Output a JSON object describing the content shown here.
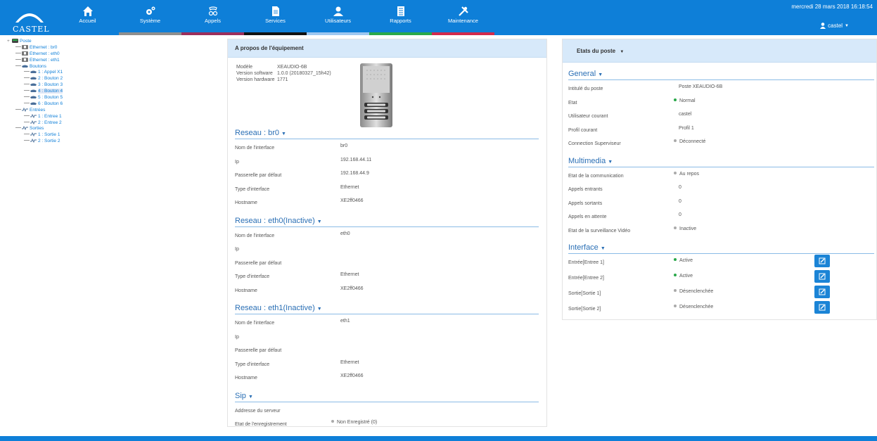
{
  "header": {
    "logo_text": "CASTEL",
    "datetime": "mercredi 28 mars 2018 16:18:54",
    "user": "castel",
    "nav": [
      {
        "label": "Accueil",
        "icon": "home-icon",
        "stripe": "#0e7fd8"
      },
      {
        "label": "Système",
        "icon": "gears-icon",
        "stripe": "#8e8e8e"
      },
      {
        "label": "Appels",
        "icon": "phone-icon",
        "stripe": "#9b2f5c"
      },
      {
        "label": "Services",
        "icon": "document-icon",
        "stripe": "#111111"
      },
      {
        "label": "Utilisateurs",
        "icon": "users-icon",
        "stripe": "#9ec7f0"
      },
      {
        "label": "Rapports",
        "icon": "report-icon",
        "stripe": "#2aa84a"
      },
      {
        "label": "Maintenance",
        "icon": "tools-icon",
        "stripe": "#d22a4c"
      }
    ]
  },
  "tree": [
    {
      "label": "Poste",
      "indent": 0,
      "icon": "device"
    },
    {
      "label": "Ethernet : br0",
      "indent": 1,
      "icon": "shield"
    },
    {
      "label": "Ethernet : eth0",
      "indent": 1,
      "icon": "shield"
    },
    {
      "label": "Ethernet : eth1",
      "indent": 1,
      "icon": "shield"
    },
    {
      "label": "Boutons",
      "indent": 1,
      "icon": "phone"
    },
    {
      "label": "1 : Appel X1",
      "indent": 2,
      "icon": "phone"
    },
    {
      "label": "2 : Bouton 2",
      "indent": 2,
      "icon": "phone"
    },
    {
      "label": "3 : Bouton 3",
      "indent": 2,
      "icon": "phone"
    },
    {
      "label": "4 : Bouton 4",
      "indent": 2,
      "icon": "phone",
      "highlight": true
    },
    {
      "label": "5 : Bouton 5",
      "indent": 2,
      "icon": "phone"
    },
    {
      "label": "6 : Bouton 6",
      "indent": 2,
      "icon": "phone"
    },
    {
      "label": "Entrées",
      "indent": 1,
      "icon": "wave"
    },
    {
      "label": "1 : Entree 1",
      "indent": 2,
      "icon": "wave"
    },
    {
      "label": "2 : Entree 2",
      "indent": 2,
      "icon": "wave"
    },
    {
      "label": "Sorties",
      "indent": 1,
      "icon": "wave"
    },
    {
      "label": "1 : Sortie 1",
      "indent": 2,
      "icon": "wave"
    },
    {
      "label": "2 : Sortie 2",
      "indent": 2,
      "icon": "wave"
    }
  ],
  "about": {
    "title": "A propos de l'équipement",
    "model_label": "Modèle",
    "model": "XEAUDIO-6B",
    "sw_label": "Version software",
    "sw": "1.0.0 (20180327_15h42)",
    "hw_label": "Version hardware",
    "hw": "1771",
    "sections": [
      {
        "title": "Reseau : br0",
        "rows": [
          {
            "k": "Nom de l'interface",
            "v": "br0"
          },
          {
            "k": "Ip",
            "v": "192.168.44.11"
          },
          {
            "k": "Passerelle par défaut",
            "v": "192.168.44.9"
          },
          {
            "k": "Type d'interface",
            "v": "Ethernet"
          },
          {
            "k": "Hostname",
            "v": "XE2ff0466"
          }
        ]
      },
      {
        "title": "Reseau : eth0(Inactive)",
        "rows": [
          {
            "k": "Nom de l'interface",
            "v": "eth0"
          },
          {
            "k": "Ip",
            "v": ""
          },
          {
            "k": "Passerelle par défaut",
            "v": ""
          },
          {
            "k": "Type d'interface",
            "v": "Ethernet"
          },
          {
            "k": "Hostname",
            "v": "XE2ff0466"
          }
        ]
      },
      {
        "title": "Reseau : eth1(Inactive)",
        "rows": [
          {
            "k": "Nom de l'interface",
            "v": "eth1"
          },
          {
            "k": "Ip",
            "v": ""
          },
          {
            "k": "Passerelle par défaut",
            "v": ""
          },
          {
            "k": "Type d'interface",
            "v": "Ethernet"
          },
          {
            "k": "Hostname",
            "v": "XE2ff0466"
          }
        ]
      },
      {
        "title": "Sip",
        "rows": [
          {
            "k": "Addresse du serveur",
            "v": ""
          },
          {
            "k": "Etat de l'enregistrement",
            "v": "Non Enregistré (0)",
            "dot": "#aaaaaa"
          }
        ]
      }
    ]
  },
  "status": {
    "title": "Etats du poste",
    "sections": [
      {
        "title": "General",
        "rows": [
          {
            "k": "Intitulé du poste",
            "v": "Poste XEAUDIO-6B"
          },
          {
            "k": "Etat",
            "v": "Normal",
            "dot": "#2aa84a"
          },
          {
            "k": "Utilisateur courant",
            "v": "castel"
          },
          {
            "k": "Profil courant",
            "v": "Profil 1"
          },
          {
            "k": "Connection Superviseur",
            "v": "Déconnecté",
            "dot": "#aaaaaa"
          }
        ]
      },
      {
        "title": "Multimedia",
        "rows": [
          {
            "k": "Etat de la communication",
            "v": "Au repos",
            "dot": "#aaaaaa"
          },
          {
            "k": "Appels entrants",
            "v": "0"
          },
          {
            "k": "Appels sortants",
            "v": "0"
          },
          {
            "k": "Appels en attente",
            "v": "0"
          },
          {
            "k": "Etat de la surveillance Vidéo",
            "v": "Inactive",
            "dot": "#aaaaaa"
          }
        ]
      },
      {
        "title": "Interface",
        "rows": [
          {
            "k": "Entrée[Entree 1]",
            "v": "Active",
            "dot": "#2aa84a",
            "edit": true
          },
          {
            "k": "Entrée[Entree 2]",
            "v": "Active",
            "dot": "#2aa84a",
            "edit": true
          },
          {
            "k": "Sortie[Sortie 1]",
            "v": "Désenclenchée",
            "dot": "#aaaaaa",
            "edit": true
          },
          {
            "k": "Sortie[Sortie 2]",
            "v": "Désenclenchée",
            "dot": "#aaaaaa",
            "edit": true
          }
        ]
      }
    ]
  }
}
